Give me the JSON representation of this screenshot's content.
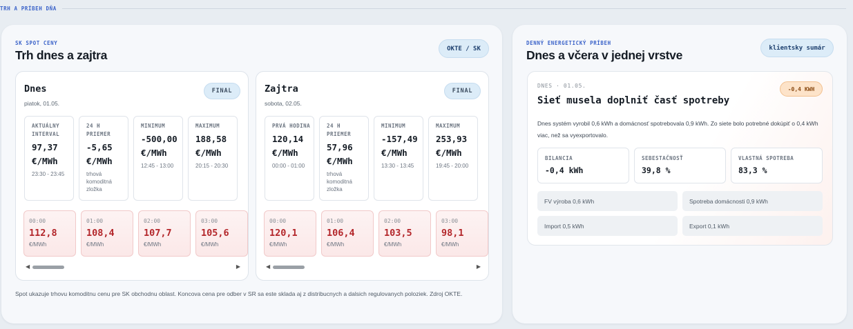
{
  "section": {
    "label": "TRH A PRÍBEH DŇA"
  },
  "market": {
    "kicker": "SK SPOT CENY",
    "title": "Trh dnes a zajtra",
    "source_button": "OKTE / SK",
    "days": [
      {
        "name": "Dnes",
        "date": "piatok, 01.05.",
        "badge": "FINAL",
        "stats": [
          {
            "label": "AKTUÁLNY INTERVAL",
            "value": "97,37 €/MWh",
            "note": "23:30 - 23:45"
          },
          {
            "label": "24 H PRIEMER",
            "value": "-5,65 €/MWh",
            "note": "trhová komoditná zložka"
          },
          {
            "label": "MINIMUM",
            "value": "-500,00 €/MWh",
            "note": "12:45 - 13:00"
          },
          {
            "label": "MAXIMUM",
            "value": "188,58 €/MWh",
            "note": "20:15 - 20:30"
          }
        ],
        "hours": [
          {
            "time": "00:00",
            "price": "112,8",
            "unit": "€/MWh"
          },
          {
            "time": "01:00",
            "price": "108,4",
            "unit": "€/MWh"
          },
          {
            "time": "02:00",
            "price": "107,7",
            "unit": "€/MWh"
          },
          {
            "time": "03:00",
            "price": "105,6",
            "unit": "€/MWh"
          }
        ]
      },
      {
        "name": "Zajtra",
        "date": "sobota, 02.05.",
        "badge": "FINAL",
        "stats": [
          {
            "label": "PRVÁ HODINA",
            "value": "120,14 €/MWh",
            "note": "00:00 - 01:00"
          },
          {
            "label": "24 H PRIEMER",
            "value": "57,96 €/MWh",
            "note": "trhová komoditná zložka"
          },
          {
            "label": "MINIMUM",
            "value": "-157,49 €/MWh",
            "note": "13:30 - 13:45"
          },
          {
            "label": "MAXIMUM",
            "value": "253,93 €/MWh",
            "note": "19:45 - 20:00"
          }
        ],
        "hours": [
          {
            "time": "00:00",
            "price": "120,1",
            "unit": "€/MWh"
          },
          {
            "time": "01:00",
            "price": "106,4",
            "unit": "€/MWh"
          },
          {
            "time": "02:00",
            "price": "103,5",
            "unit": "€/MWh"
          },
          {
            "time": "03:00",
            "price": "98,1",
            "unit": "€/MWh"
          }
        ]
      }
    ],
    "footnote": "Spot ukazuje trhovu komoditnu cenu pre SK obchodnu oblast. Koncova cena pre odber v SR sa este sklada aj z distribucnych a dalsich regulovanych poloziek. Zdroj OKTE."
  },
  "story": {
    "kicker": "DENNÝ ENERGETICKÝ PRÍBEH",
    "title": "Dnes a včera v jednej vrstve",
    "summary_button": "klientsky sumár",
    "card": {
      "kicker": "DNES · 01.05.",
      "badge": "-0,4 KWH",
      "title": "Sieť musela doplniť časť spotreby",
      "description": "Dnes systém vyrobil 0,6 kWh a domácnosť spotrebovala 0,9 kWh. Zo siete bolo potrebné dokúpiť o 0,4 kWh viac, než sa vyexportovalo.",
      "kpis": [
        {
          "label": "BILANCIA",
          "value": "-0,4 kWh"
        },
        {
          "label": "SEBESTAČNOSŤ",
          "value": "39,8 %"
        },
        {
          "label": "VLASTNÁ SPOTREBA",
          "value": "83,3 %"
        }
      ],
      "facts": [
        "FV výroba 0,6 kWh",
        "Spotreba domácnosti 0,9 kWh",
        "Import 0,5 kWh",
        "Export 0,1 kWh"
      ]
    }
  }
}
